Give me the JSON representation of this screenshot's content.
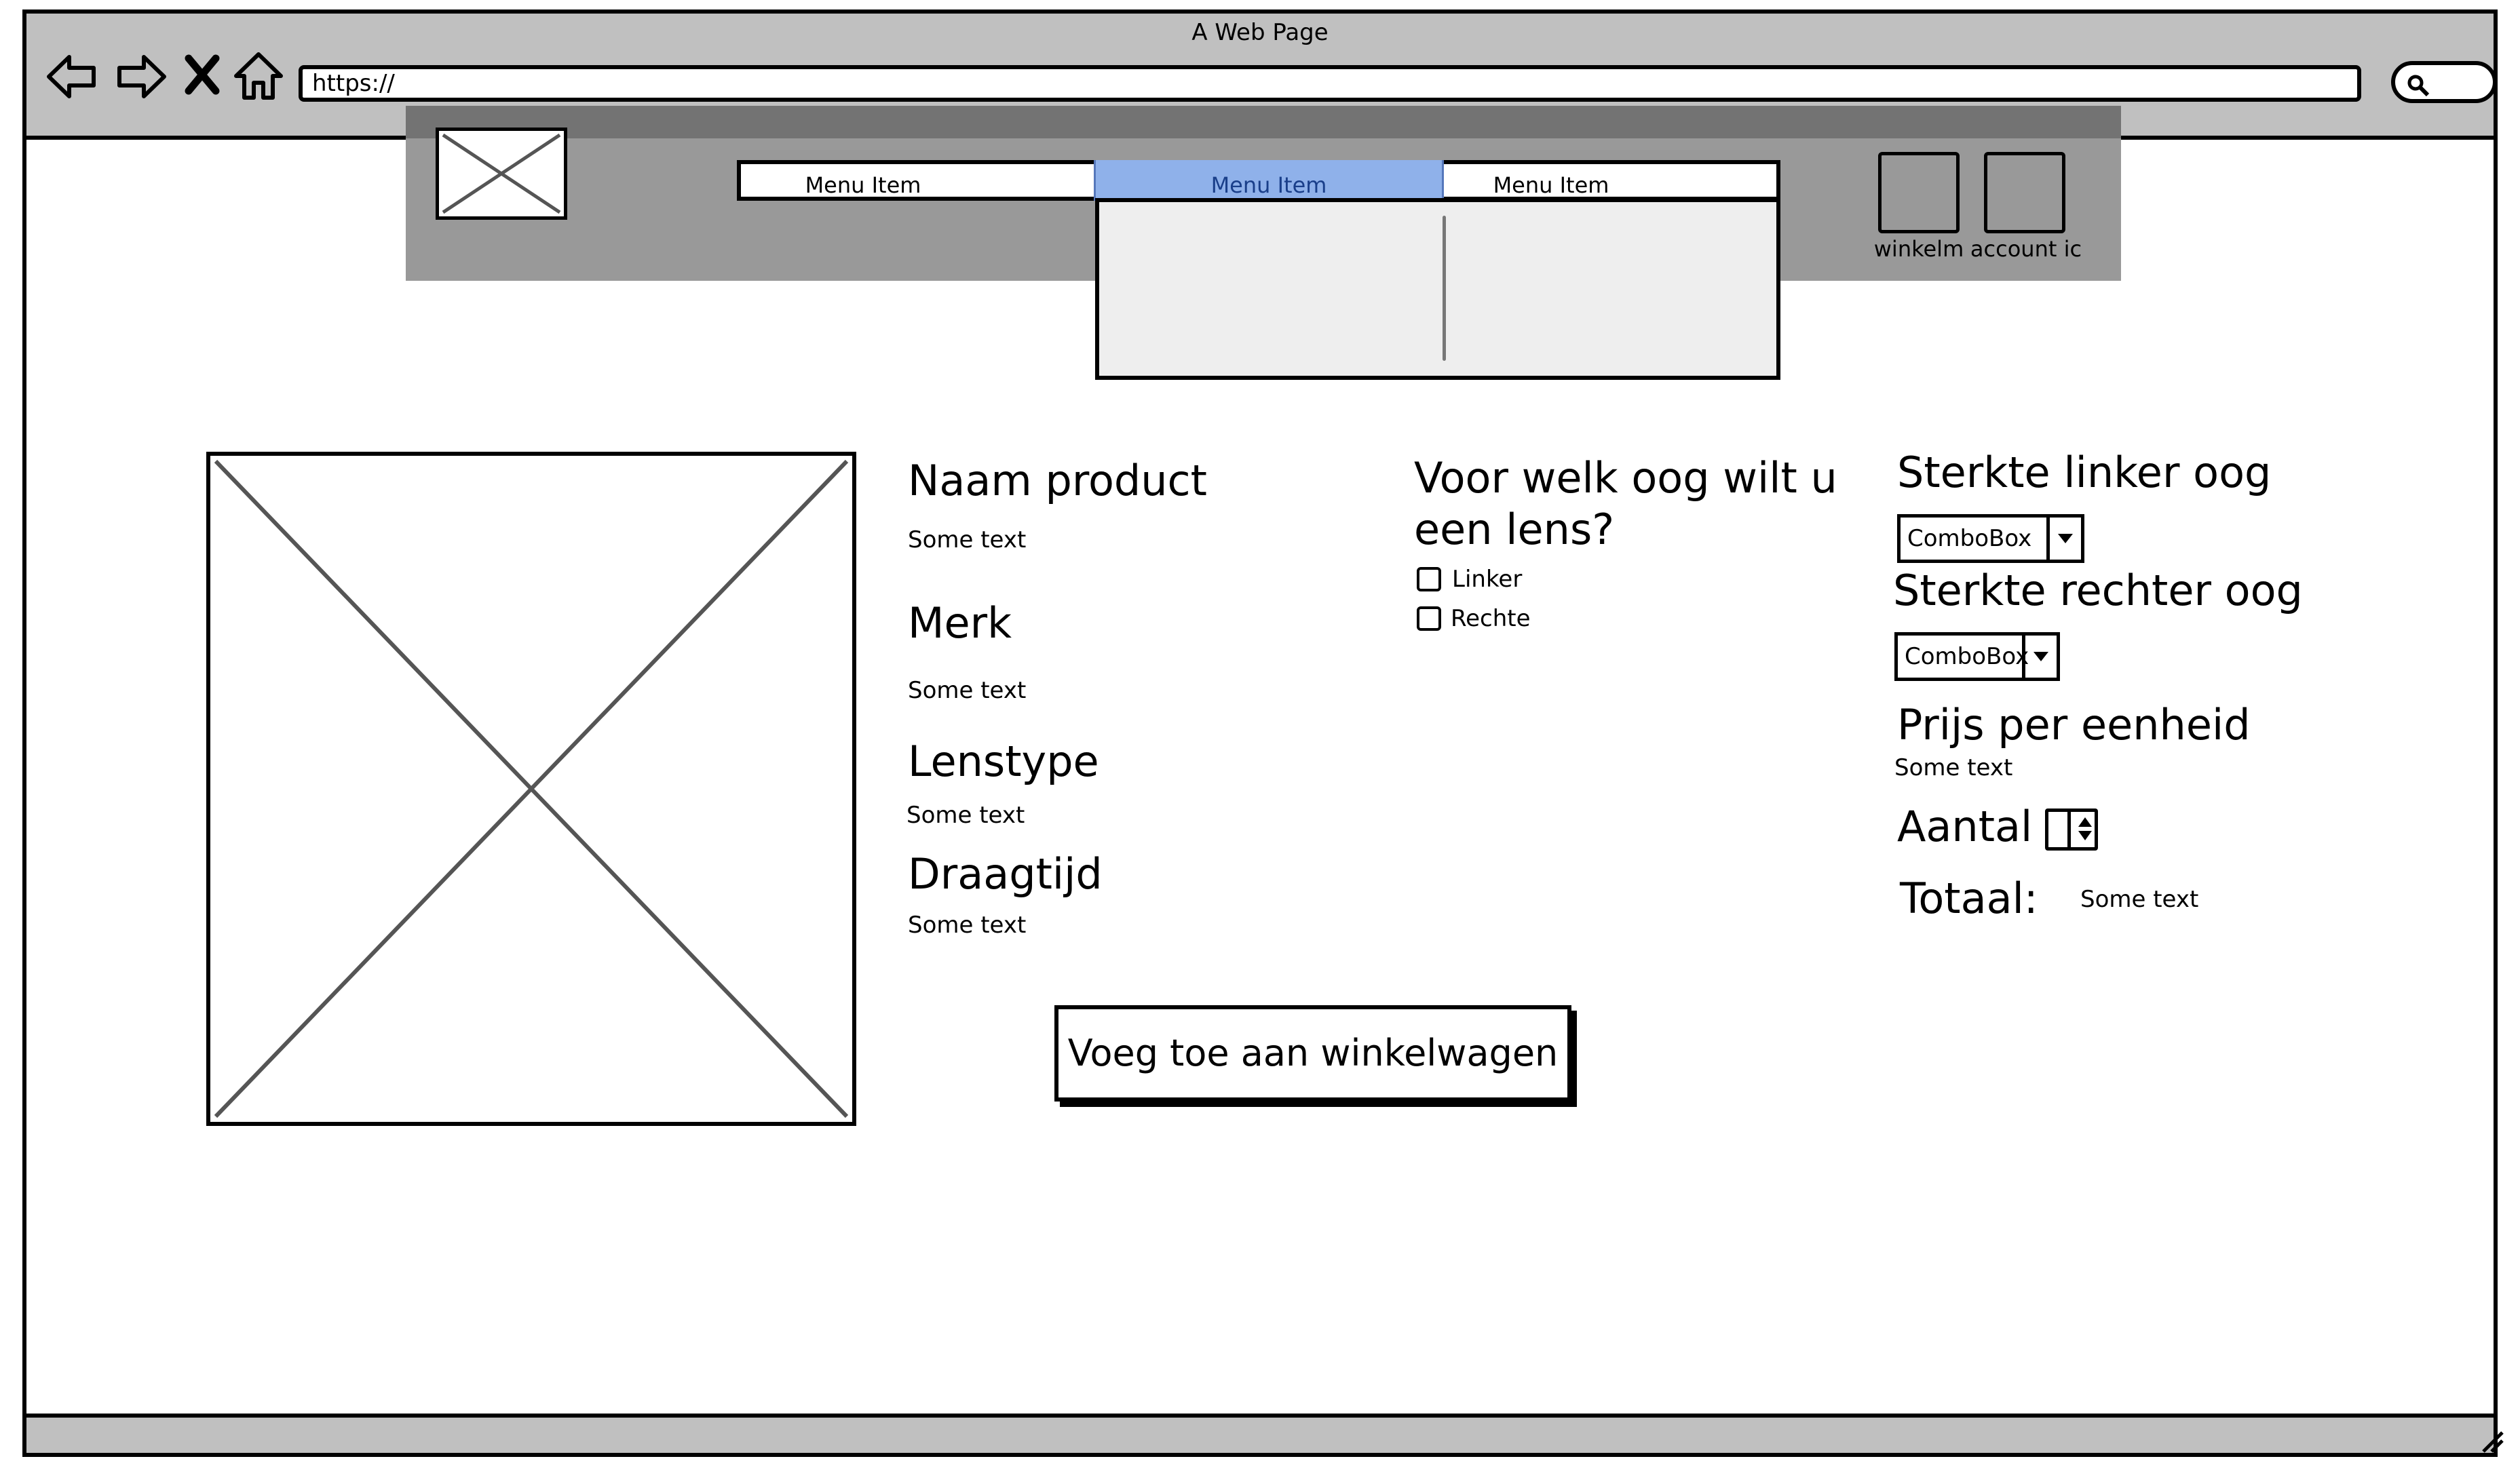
{
  "browser": {
    "title": "A Web Page",
    "url": "https://"
  },
  "header": {
    "menu_items": [
      "Menu Item",
      "Menu Item",
      "Menu Item"
    ],
    "selected_menu_index": 1,
    "cart_label": "winkelm",
    "account_label": "account ic"
  },
  "product": {
    "name_heading": "Naam product",
    "name_text": "Some text",
    "brand_heading": "Merk",
    "brand_text": "Some text",
    "lenstype_heading": "Lenstype",
    "lenstype_text": "Some text",
    "wear_heading": "Draagtijd",
    "wear_text": "Some text"
  },
  "eye_choice": {
    "heading_line1": "Voor welk oog wilt u",
    "heading_line2": "een lens?",
    "left_label": "Linker",
    "right_label": "Rechte"
  },
  "options": {
    "left_strength_heading": "Sterkte linker oog",
    "left_combo_value": "ComboBox",
    "right_strength_heading": "Sterkte rechter oog",
    "right_combo_value": "ComboBox",
    "price_heading": "Prijs per eenheid",
    "price_text": "Some text",
    "quantity_heading": "Aantal",
    "total_heading": "Totaal:",
    "total_text": "Some text"
  },
  "actions": {
    "add_to_cart_label": "Voeg toe aan winkelwagen"
  }
}
